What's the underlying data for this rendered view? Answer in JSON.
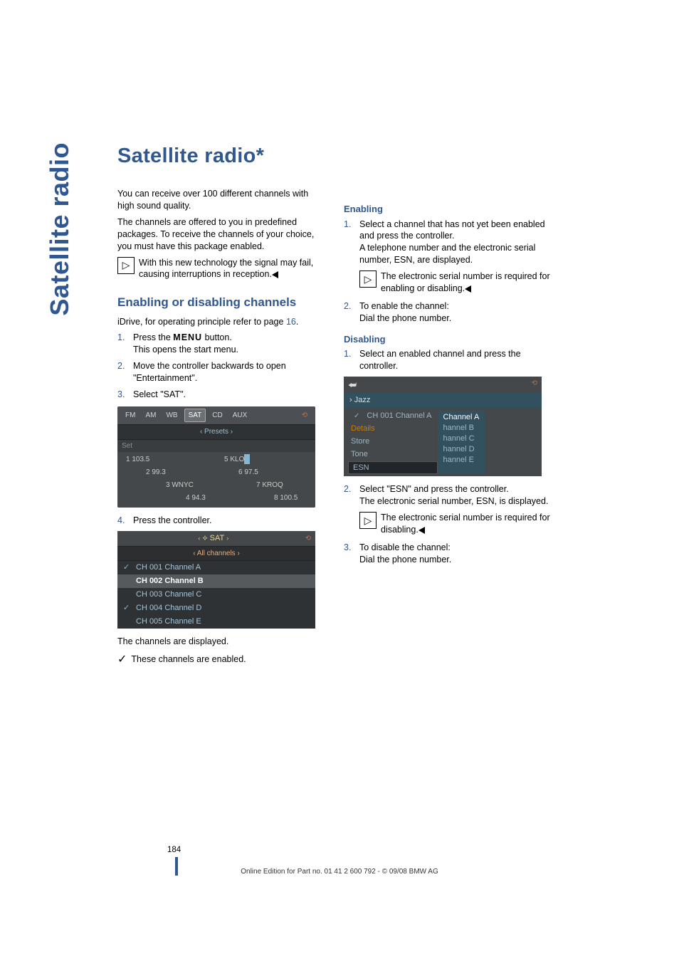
{
  "vtab": "Satellite radio",
  "title": "Satellite radio*",
  "col1": {
    "intro1": "You can receive over 100 different channels with high sound quality.",
    "intro2": "The channels are offered to you in predefined packages. To receive the channels of your choice, you must have this package enabled.",
    "note1": "With this new technology the signal may fail, causing interruptions in reception.",
    "h2": "Enabling or disabling channels",
    "idrive_pre": "iDrive, for operating principle refer to page ",
    "idrive_page": "16",
    "idrive_post": ".",
    "steps": [
      {
        "n": "1.",
        "t1": "Press the ",
        "menu": "MENU",
        "t2": " button.",
        "t3": "This opens the start menu."
      },
      {
        "n": "2.",
        "t1": "Move the controller backwards to open \"Entertainment\"."
      },
      {
        "n": "3.",
        "t1": "Select \"SAT\"."
      }
    ],
    "fig1": {
      "tabs": [
        "FM",
        "AM",
        "WB",
        "SAT",
        "CD",
        "AUX"
      ],
      "sub": "‹  Presets  ›",
      "set": "Set",
      "p1": "1 103.5",
      "p5": "5 KLOS",
      "p2": "2 99.3",
      "p6": "6 97.5",
      "p3": "3 WNYC",
      "p7": "7 KROQ",
      "p4": "4 94.3",
      "p8": "8 100.5"
    },
    "step4": {
      "n": "4.",
      "t": "Press the controller."
    },
    "fig2": {
      "top": "‹     SAT  ›",
      "sub": "‹ All channels ›",
      "rows": [
        {
          "ck": "✓",
          "txt": "CH 001 Channel A"
        },
        {
          "ck": "",
          "txt": "CH 002 Channel B",
          "sel": true
        },
        {
          "ck": "",
          "txt": "CH 003 Channel C"
        },
        {
          "ck": "✓",
          "txt": "CH 004 Channel D"
        },
        {
          "ck": "",
          "txt": "CH 005 Channel E"
        }
      ]
    },
    "post1": "The channels are displayed.",
    "post2": "These channels are enabled."
  },
  "col2": {
    "en_h": "Enabling",
    "en_step1a": "Select a channel that has not yet been enabled and press the controller.",
    "en_step1b": "A telephone number and the electronic serial number, ESN, are displayed.",
    "en_note": "The electronic serial number is required for enabling or disabling.",
    "en_step2a": "To enable the channel:",
    "en_step2b": "Dial the phone number.",
    "dis_h": "Disabling",
    "dis_step1": "Select an enabled channel and press the controller.",
    "fig3": {
      "jazz": "› Jazz",
      "chkrow": "CH 001 Channel A",
      "menu": [
        "Details",
        "Store",
        "Tone",
        "ESN"
      ],
      "popup": [
        "Channel A",
        "hannel B",
        "hannel C",
        "hannel D",
        "hannel E"
      ]
    },
    "dis_step2a": "Select \"ESN\" and press the controller.",
    "dis_step2b": "The electronic serial number, ESN, is displayed.",
    "dis_note": "The electronic serial number is required for disabling.",
    "dis_step3a": "To disable the channel:",
    "dis_step3b": "Dial the phone number."
  },
  "pagenum": "184",
  "footer": "Online Edition for Part no. 01 41 2 600 792 - © 09/08 BMW AG"
}
